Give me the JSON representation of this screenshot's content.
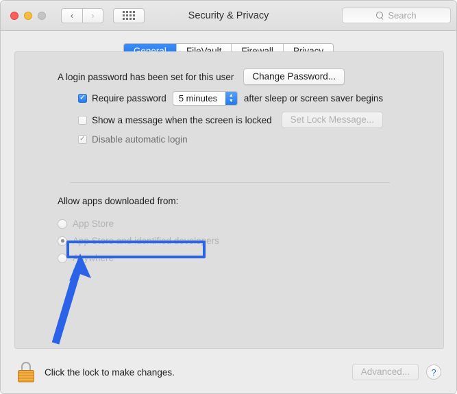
{
  "window": {
    "title": "Security & Privacy",
    "traffic_lights": [
      "close",
      "minimize",
      "zoom"
    ],
    "nav_back": "‹",
    "nav_forward": "›"
  },
  "search": {
    "placeholder": "Search"
  },
  "tabs": [
    {
      "label": "General",
      "active": true
    },
    {
      "label": "FileVault",
      "active": false
    },
    {
      "label": "Firewall",
      "active": false
    },
    {
      "label": "Privacy",
      "active": false
    }
  ],
  "general": {
    "password_status": "A login password has been set for this user",
    "change_password_label": "Change Password...",
    "require_password": {
      "label": "Require password",
      "checked": true,
      "value": "5 minutes",
      "suffix": "after sleep or screen saver begins"
    },
    "show_message": {
      "label": "Show a message when the screen is locked",
      "checked": false,
      "button_label": "Set Lock Message...",
      "button_disabled": true
    },
    "disable_auto_login": {
      "label": "Disable automatic login",
      "checked": true,
      "disabled": true
    }
  },
  "allow_apps": {
    "title": "Allow apps downloaded from:",
    "options": [
      {
        "label": "App Store",
        "selected": false
      },
      {
        "label": "App Store and identified developers",
        "selected": true
      },
      {
        "label": "Anywhere",
        "selected": false
      }
    ]
  },
  "annotation": {
    "color": "#2b63e8",
    "highlighted_option": "Anywhere"
  },
  "bottom": {
    "lock_text": "Click the lock to make changes.",
    "advanced_label": "Advanced...",
    "advanced_disabled": true,
    "help_label": "?"
  }
}
